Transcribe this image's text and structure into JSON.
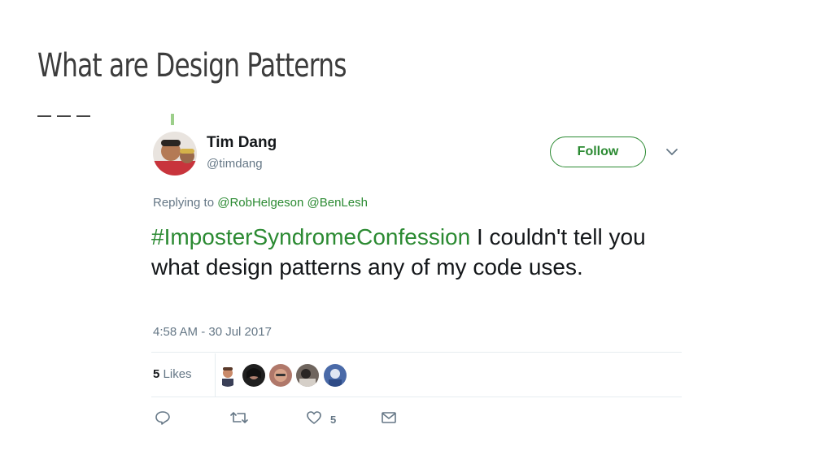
{
  "slide": {
    "title": "What are Design Patterns"
  },
  "tweet": {
    "author_name": "Tim Dang",
    "author_handle": "@timdang",
    "follow_label": "Follow",
    "replying_prefix": "Replying to",
    "replying_to": [
      "@RobHelgeson",
      "@BenLesh"
    ],
    "hashtag": "#ImposterSyndromeConfession",
    "body": "I couldn't tell you what design patterns any of my code uses.",
    "timestamp": "4:58 AM - 30 Jul 2017",
    "likes_count": "5",
    "likes_label": "Likes",
    "like_action_count": "5",
    "accent_color": "#2b8a32"
  }
}
